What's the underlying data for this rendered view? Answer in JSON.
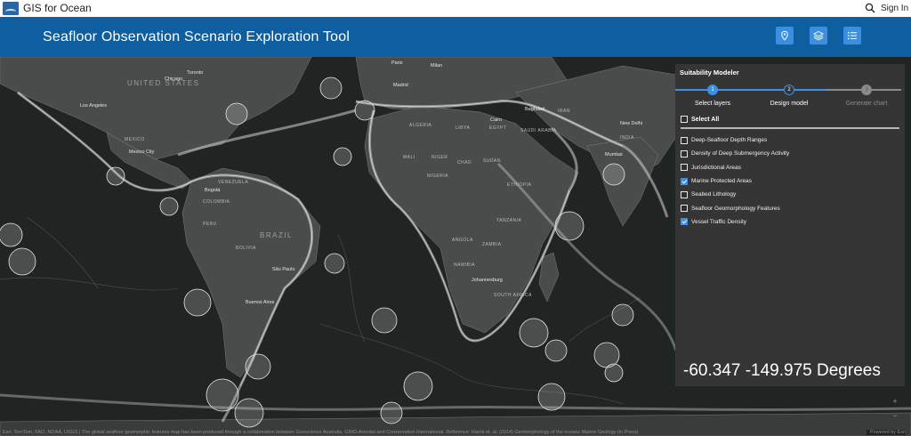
{
  "topbar": {
    "app_title": "GIS for Ocean",
    "sign_in_label": "Sign In"
  },
  "header": {
    "tool_title": "Seafloor Observation Scenario Exploration Tool"
  },
  "panel": {
    "title": "Suitability Modeler",
    "steps": [
      {
        "number": "1",
        "label": "Select layers"
      },
      {
        "number": "2",
        "label": "Design model"
      },
      {
        "number": "3",
        "label": "Generate chart"
      }
    ],
    "select_all_label": "Select All",
    "layers": [
      {
        "label": "Deep-Seafloor Depth Ranges",
        "checked": false
      },
      {
        "label": "Density of Deep Submergency Activity",
        "checked": false
      },
      {
        "label": "Jurisdictional Areas",
        "checked": false
      },
      {
        "label": "Marine Protected Areas",
        "checked": true
      },
      {
        "label": "Seabed Lithology",
        "checked": false
      },
      {
        "label": "Seafloor Geomorphology Features",
        "checked": false
      },
      {
        "label": "Vessel Traffic Density",
        "checked": true
      }
    ],
    "coordinates": "-60.347 -149.975 Degrees"
  },
  "map": {
    "places": {
      "united_states": "UNITED STATES",
      "brazil": "BRAZIL",
      "toronto": "Toronto",
      "chicago": "Chicago",
      "los_angeles": "Los Angeles",
      "mexico_city": "Mexico City",
      "mexico": "MEXICO",
      "bogota": "Bogotá",
      "venezuela": "VENEZUELA",
      "colombia": "COLOMBIA",
      "peru": "PERU",
      "bolivia": "BOLIVIA",
      "sao_paulo": "São Paulo",
      "buenos_aires": "Buenos Aires",
      "paris": "Paris",
      "milan": "Milan",
      "madrid": "Madrid",
      "algeria": "ALGERIA",
      "libya": "LIBYA",
      "egypt": "EGYPT",
      "cairo": "Cairo",
      "mali": "MALI",
      "niger": "NIGER",
      "chad": "CHAD",
      "sudan": "SUDAN",
      "nigeria": "NIGERIA",
      "ethiopia": "ETHIOPIA",
      "tanzania": "TANZANIA",
      "angola": "ANGOLA",
      "zambia": "ZAMBIA",
      "namibia": "NAMIBIA",
      "johannesburg": "Johannesburg",
      "south_africa": "SOUTH AFRICA",
      "baghdad": "Baghdad",
      "iran": "IRAN",
      "saudi_arabia": "SAUDI ARABIA",
      "new_delhi": "New Delhi",
      "india": "INDIA",
      "mumbai": "Mumbai"
    },
    "attribution": "Esri, TomTom, FAO, NOAA, USGS | The global seafloor geomorphic features map has been produced through a collaboration between Geoscience Australia, GRID-Arendal and Conservation International. Reference: Harris et. al. (2014) Geomorphology of the oceans Marine Geology (in Press)",
    "powered_by": "Powered by Esri",
    "zoom_in": "+",
    "zoom_out": "−"
  },
  "colors": {
    "header_blue": "#0f5fa0",
    "button_blue": "#3a8fe0",
    "accent_blue": "#3d8fe8",
    "panel_bg": "#353535",
    "land": "#4a4c4b",
    "ocean": "#202423"
  }
}
